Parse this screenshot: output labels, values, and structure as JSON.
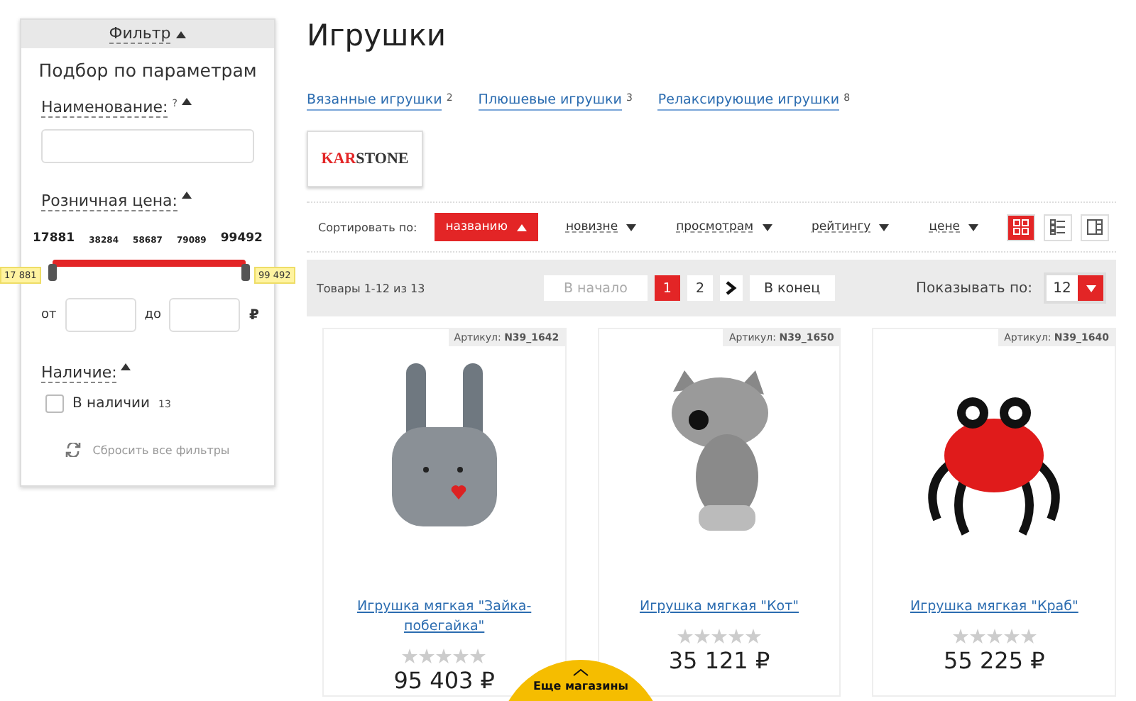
{
  "filter": {
    "toggle": "Фильтр",
    "title": "Подбор по параметрам",
    "name_field": {
      "label": "Наименование:",
      "hint_mark": "?",
      "expanded": true
    },
    "price": {
      "label": "Розничная цена:",
      "expanded": true,
      "ticks": [
        "17881",
        "38284",
        "58687",
        "79089",
        "99492"
      ],
      "level": 1,
      "min_badge": "17 881",
      "max_badge": "99 492",
      "from_label": "от",
      "to_label": "до",
      "currency": "₽"
    },
    "availability": {
      "label": "Наличие:",
      "expanded": true,
      "option": {
        "label": "В наличии",
        "count": "13",
        "checked": false
      }
    },
    "reset": "Сбросить все фильтры"
  },
  "page_title": "Игрушки",
  "subcategories": [
    {
      "label": "Вязанные игрушки",
      "count": "2"
    },
    {
      "label": "Плюшевые игрушки",
      "count": "3"
    },
    {
      "label": "Релаксирующие игрушки",
      "count": "8"
    }
  ],
  "brand": {
    "part1": "KAR",
    "part2": "STONE"
  },
  "sort": {
    "label": "Сортировать по:",
    "options": [
      {
        "label": "названию",
        "selected": true
      },
      {
        "label": "новизне",
        "selected": false
      },
      {
        "label": "просмотрам",
        "selected": false
      },
      {
        "label": "рейтингу",
        "selected": false
      },
      {
        "label": "цене",
        "selected": false
      }
    ],
    "views": [
      {
        "kind": "grid",
        "selected": true
      },
      {
        "kind": "list",
        "selected": false
      },
      {
        "kind": "table",
        "selected": false
      }
    ]
  },
  "pager": {
    "summary": "Товары 1-12 из 13",
    "first": {
      "label": "В начало",
      "disabled": true
    },
    "pages": [
      {
        "label": "1",
        "selected": true
      },
      {
        "label": "2",
        "selected": false
      }
    ],
    "last": {
      "label": "В конец",
      "disabled": false
    },
    "per_page_label": "Показывать по:",
    "per_page": "12"
  },
  "products": [
    {
      "kind": "bunny",
      "sku_label": "Артикул:",
      "sku": "N39_1642",
      "name": "Игрушка мягкая \"Зайка-побегайка\"",
      "stars": 0,
      "price": "95 403 ₽"
    },
    {
      "kind": "cat",
      "sku_label": "Артикул:",
      "sku": "N39_1650",
      "name": "Игрушка мягкая \"Кот\"",
      "stars": 0,
      "price": "35 121 ₽"
    },
    {
      "kind": "crab",
      "sku_label": "Артикул:",
      "sku": "N39_1640",
      "name": "Игрушка мягкая \"Краб\"",
      "stars": 0,
      "price": "55 225 ₽"
    }
  ],
  "more_shops": "Еще магазины"
}
